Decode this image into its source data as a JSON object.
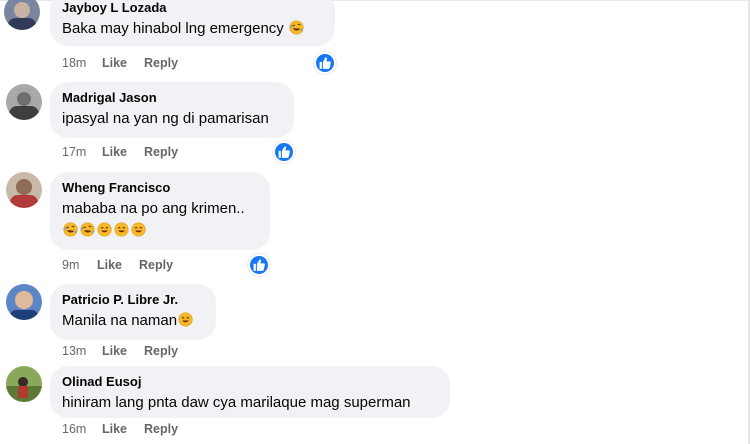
{
  "comments": [
    {
      "author": "Jayboy L Lozada",
      "text": "Baka may hinabol lng emergency",
      "time": "18m",
      "like": "Like",
      "reply": "Reply"
    },
    {
      "author": "Madrigal Jason",
      "text": "ipasyal na yan ng di pamarisan",
      "time": "17m",
      "like": "Like",
      "reply": "Reply"
    },
    {
      "author": "Wheng Francisco",
      "text": "mababa na po ang krimen..",
      "time": "9m",
      "like": "Like",
      "reply": "Reply"
    },
    {
      "author": "Patricio P. Libre Jr.",
      "text": "Manila na naman",
      "time": "13m",
      "like": "Like",
      "reply": "Reply"
    },
    {
      "author": "Olinad Eusoj",
      "text": "hiniram lang pnta daw cya marilaque mag superman",
      "time": "16m",
      "like": "Like",
      "reply": "Reply"
    }
  ],
  "icons": {
    "like_reaction": "thumbs-up-icon",
    "laughing": "rofl-emoji-icon",
    "smiling": "smile-emoji-icon"
  },
  "colors": {
    "reaction_blue": "#1877f2",
    "bubble_bg": "#f0f2f5",
    "meta_gray": "#65676b"
  }
}
